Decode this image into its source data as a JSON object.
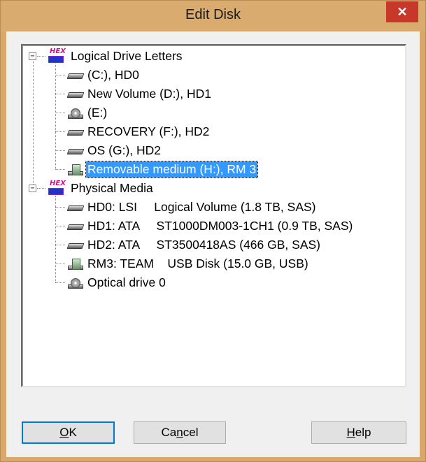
{
  "window": {
    "title": "Edit Disk",
    "close_label": "✕"
  },
  "tree": {
    "groups": [
      {
        "label": "Logical Drive Letters",
        "icon": "hex-icon",
        "expander": "−",
        "items": [
          {
            "label": "(C:), HD0",
            "icon": "hard-drive-icon"
          },
          {
            "label": "New Volume (D:), HD1",
            "icon": "hard-drive-icon"
          },
          {
            "label": "(E:)",
            "icon": "optical-drive-icon"
          },
          {
            "label": "RECOVERY (F:), HD2",
            "icon": "hard-drive-icon"
          },
          {
            "label": "OS (G:), HD2",
            "icon": "hard-drive-icon"
          },
          {
            "label": "Removable medium (H:), RM 3",
            "icon": "usb-drive-icon",
            "selected": true
          }
        ]
      },
      {
        "label": "Physical Media",
        "icon": "hex-icon",
        "expander": "−",
        "items": [
          {
            "label": "HD0: LSI     Logical Volume (1.8 TB, SAS)",
            "icon": "hard-drive-icon"
          },
          {
            "label": "HD1: ATA     ST1000DM003-1CH1 (0.9 TB, SAS)",
            "icon": "hard-drive-icon"
          },
          {
            "label": "HD2: ATA     ST3500418AS (466 GB, SAS)",
            "icon": "hard-drive-icon"
          },
          {
            "label": "RM3: TEAM    USB Disk (15.0 GB, USB)",
            "icon": "usb-drive-icon"
          },
          {
            "label": "Optical drive 0",
            "icon": "optical-drive-icon"
          }
        ]
      }
    ],
    "hex_icon_text": "HEX"
  },
  "buttons": {
    "ok": {
      "mnemonic": "O",
      "rest": "K"
    },
    "cancel": {
      "pre": "Ca",
      "mnemonic": "n",
      "rest": "cel"
    },
    "help": {
      "mnemonic": "H",
      "rest": "elp"
    }
  }
}
